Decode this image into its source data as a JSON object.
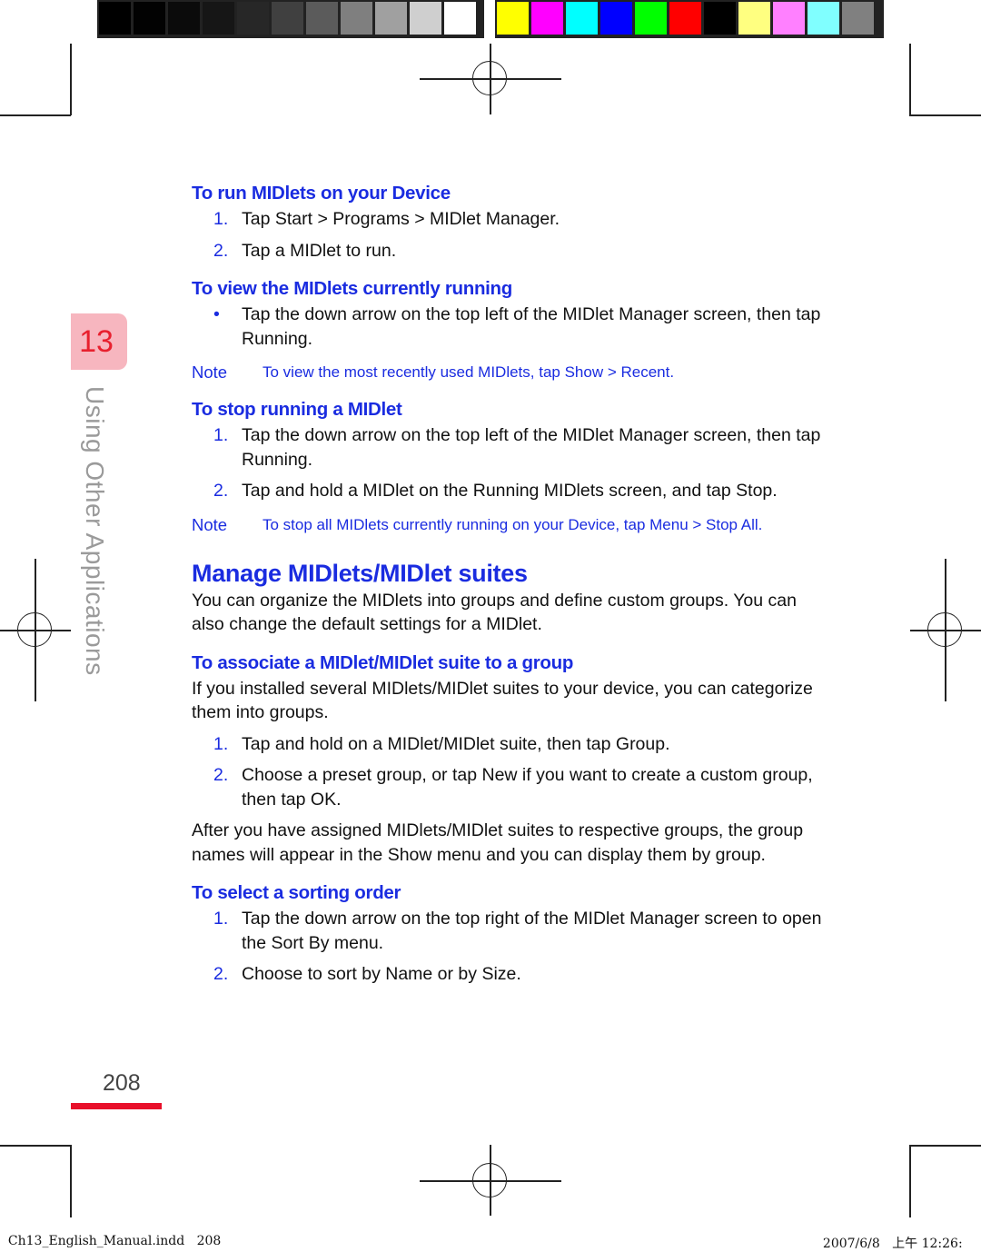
{
  "colorbars": {
    "grayscale": [
      "#000000",
      "#020202",
      "#0b0b0b",
      "#161616",
      "#272727",
      "#404040",
      "#5b5b5b",
      "#7f7f7f",
      "#a0a0a0",
      "#cfcfcf",
      "#ffffff"
    ],
    "colors": [
      "#ffff00",
      "#ff00ff",
      "#00ffff",
      "#0000ff",
      "#00ff00",
      "#ff0000",
      "#000000",
      "#ffff80",
      "#ff80ff",
      "#80ffff",
      "#808080"
    ]
  },
  "chapter": {
    "number": "13",
    "title": "Using Other Applications",
    "tab_color": "#f7b6bf",
    "accent": "#e8202e"
  },
  "sections": {
    "run": {
      "heading": "To run MIDlets on your Device",
      "steps": [
        {
          "num": "1.",
          "text": "Tap Start > Programs > MIDlet Manager."
        },
        {
          "num": "2.",
          "text": "Tap a MIDlet to run."
        }
      ]
    },
    "view": {
      "heading": "To view the MIDlets currently running",
      "bullets": [
        {
          "mark": "•",
          "text": "Tap the down arrow on the top left of the MIDlet Manager screen, then tap Running."
        }
      ],
      "note_label": "Note",
      "note_text": "To view the most recently used MIDlets, tap Show > Recent."
    },
    "stop": {
      "heading": "To stop running a MIDlet",
      "steps": [
        {
          "num": "1.",
          "text": "Tap the down arrow on the top left of the MIDlet Manager screen, then tap Running."
        },
        {
          "num": "2.",
          "text": "Tap and hold a MIDlet on the Running MIDlets screen, and tap Stop."
        }
      ],
      "note_label": "Note",
      "note_text": "To stop all MIDlets currently running on your Device, tap Menu > Stop All."
    },
    "manage": {
      "heading": "Manage MIDlets/MIDlet suites",
      "intro": "You can organize the MIDlets into groups and define custom groups. You can also change the default settings for a MIDlet."
    },
    "associate": {
      "heading": "To associate a MIDlet/MIDlet suite to a group",
      "intro": "If you installed several MIDlets/MIDlet suites to your device, you can categorize them into groups.",
      "steps": [
        {
          "num": "1.",
          "text": "Tap and hold on a MIDlet/MIDlet suite, then tap Group."
        },
        {
          "num": "2.",
          "text": "Choose a preset group, or tap New if you want to create a custom group, then tap OK."
        }
      ],
      "outro": "After you have assigned MIDlets/MIDlet suites to respective groups, the group names will appear in the Show menu and you can display them by group."
    },
    "sort": {
      "heading": "To select a sorting order",
      "steps": [
        {
          "num": "1.",
          "text": "Tap the down arrow on the top right of the MIDlet Manager screen to open the Sort By menu."
        },
        {
          "num": "2.",
          "text": "Choose to sort by Name or by Size."
        }
      ]
    }
  },
  "page": {
    "number": "208",
    "accent": "#e8102a"
  },
  "slug": {
    "file": "Ch13_English_Manual.indd",
    "page": "208",
    "date": "2007/6/8",
    "time": "上午 12:26:"
  },
  "colors": {
    "heading_blue": "#1a2ce0",
    "body_text": "#111111"
  }
}
